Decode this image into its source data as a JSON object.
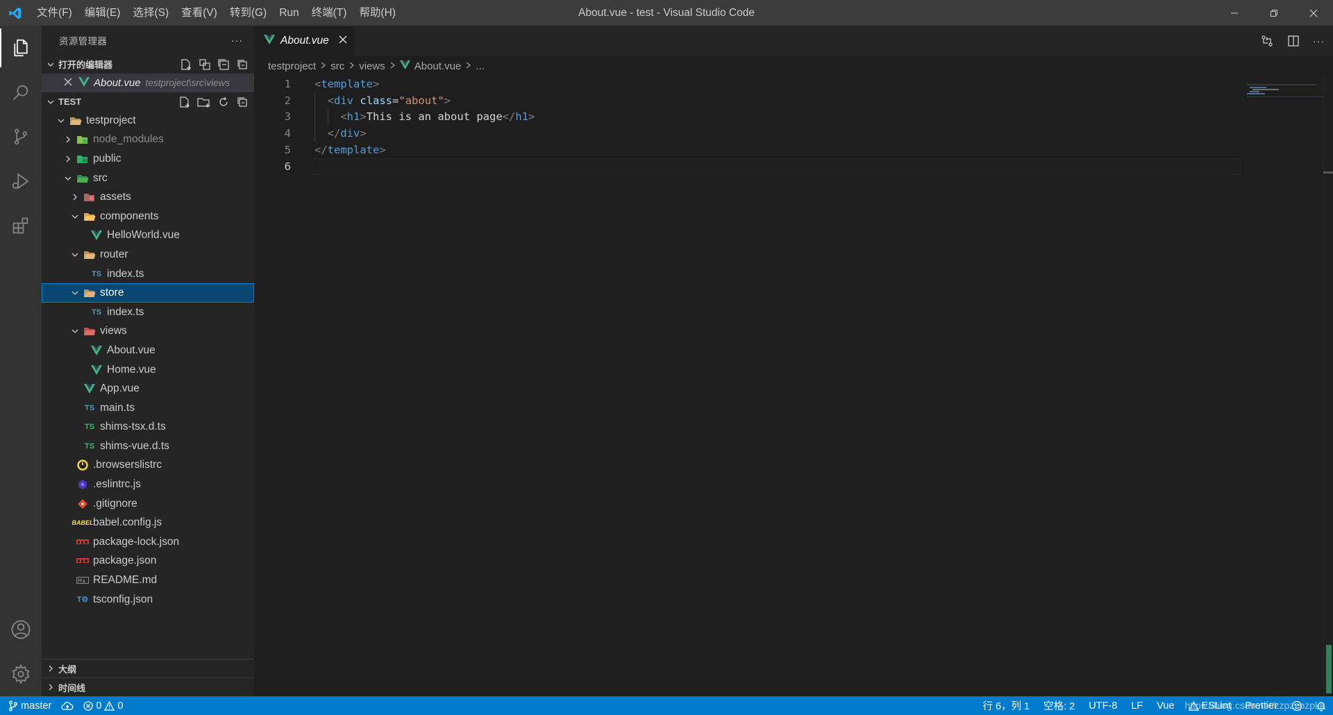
{
  "window": {
    "title": "About.vue - test - Visual Studio Code",
    "menu": [
      "文件(F)",
      "编辑(E)",
      "选择(S)",
      "查看(V)",
      "转到(G)",
      "Run",
      "终端(T)",
      "帮助(H)"
    ]
  },
  "sidebar": {
    "title": "资源管理器",
    "more": "···",
    "open_editors": {
      "label": "打开的编辑器",
      "items": [
        {
          "name": "About.vue",
          "path": "testproject\\src\\views"
        }
      ]
    },
    "workspace": {
      "label": "TEST",
      "tree": [
        {
          "name": "testproject",
          "depth": 0,
          "kind": "folder-open",
          "expanded": true
        },
        {
          "name": "node_modules",
          "depth": 1,
          "kind": "node",
          "expanded": false,
          "dim": true
        },
        {
          "name": "public",
          "depth": 1,
          "kind": "public",
          "expanded": false
        },
        {
          "name": "src",
          "depth": 1,
          "kind": "src",
          "expanded": true
        },
        {
          "name": "assets",
          "depth": 2,
          "kind": "assets",
          "expanded": false
        },
        {
          "name": "components",
          "depth": 2,
          "kind": "components",
          "expanded": true
        },
        {
          "name": "HelloWorld.vue",
          "depth": 3,
          "kind": "vue"
        },
        {
          "name": "router",
          "depth": 2,
          "kind": "folder-open",
          "expanded": true
        },
        {
          "name": "index.ts",
          "depth": 3,
          "kind": "ts"
        },
        {
          "name": "store",
          "depth": 2,
          "kind": "folder-open",
          "expanded": true,
          "selected": true
        },
        {
          "name": "index.ts",
          "depth": 3,
          "kind": "ts"
        },
        {
          "name": "views",
          "depth": 2,
          "kind": "views",
          "expanded": true
        },
        {
          "name": "About.vue",
          "depth": 3,
          "kind": "vue"
        },
        {
          "name": "Home.vue",
          "depth": 3,
          "kind": "vue"
        },
        {
          "name": "App.vue",
          "depth": 2,
          "kind": "vue"
        },
        {
          "name": "main.ts",
          "depth": 2,
          "kind": "ts"
        },
        {
          "name": "shims-tsx.d.ts",
          "depth": 2,
          "kind": "tsd"
        },
        {
          "name": "shims-vue.d.ts",
          "depth": 2,
          "kind": "tsd"
        },
        {
          "name": ".browserslistrc",
          "depth": 1,
          "kind": "browserslist"
        },
        {
          "name": ".eslintrc.js",
          "depth": 1,
          "kind": "eslint"
        },
        {
          "name": ".gitignore",
          "depth": 1,
          "kind": "git"
        },
        {
          "name": "babel.config.js",
          "depth": 1,
          "kind": "babel"
        },
        {
          "name": "package-lock.json",
          "depth": 1,
          "kind": "npm"
        },
        {
          "name": "package.json",
          "depth": 1,
          "kind": "npm"
        },
        {
          "name": "README.md",
          "depth": 1,
          "kind": "md"
        },
        {
          "name": "tsconfig.json",
          "depth": 1,
          "kind": "tsconfig"
        }
      ]
    },
    "outline_label": "大纲",
    "timeline_label": "时间线"
  },
  "editor": {
    "tab": {
      "label": "About.vue"
    },
    "breadcrumb": [
      "testproject",
      "src",
      "views",
      "About.vue",
      "..."
    ],
    "lines": [
      {
        "n": "1",
        "tokens": [
          [
            "punct",
            "<"
          ],
          [
            "tag",
            "template"
          ],
          [
            "punct",
            ">"
          ]
        ]
      },
      {
        "n": "2",
        "tokens": [
          [
            "plain",
            "  "
          ],
          [
            "punct",
            "<"
          ],
          [
            "tag",
            "div"
          ],
          [
            "plain",
            " "
          ],
          [
            "attr",
            "class"
          ],
          [
            "plain",
            "="
          ],
          [
            "str",
            "\"about\""
          ],
          [
            "punct",
            ">"
          ]
        ]
      },
      {
        "n": "3",
        "tokens": [
          [
            "plain",
            "    "
          ],
          [
            "punct",
            "<"
          ],
          [
            "tag",
            "h1"
          ],
          [
            "punct",
            ">"
          ],
          [
            "plain",
            "This is an about page"
          ],
          [
            "punct",
            "</"
          ],
          [
            "tag",
            "h1"
          ],
          [
            "punct",
            ">"
          ]
        ]
      },
      {
        "n": "4",
        "tokens": [
          [
            "plain",
            "  "
          ],
          [
            "punct",
            "</"
          ],
          [
            "tag",
            "div"
          ],
          [
            "punct",
            ">"
          ]
        ]
      },
      {
        "n": "5",
        "tokens": [
          [
            "punct",
            "</"
          ],
          [
            "tag",
            "template"
          ],
          [
            "punct",
            ">"
          ]
        ]
      },
      {
        "n": "6",
        "tokens": [],
        "current": true
      }
    ]
  },
  "statusbar": {
    "branch": "master",
    "errors": "0",
    "warnings": "0",
    "position": "行 6，列 1",
    "spaces": "空格: 2",
    "encoding": "UTF-8",
    "eol": "LF",
    "language": "Vue",
    "eslint": "ESLint",
    "prettier": "Prettier",
    "watermark": "https://blog.csdn.net/zzpzzpzpkk"
  },
  "colors": {
    "accent": "#007acc",
    "vue": "#41b883",
    "ts": "#3178c6",
    "selected": "#094771"
  }
}
